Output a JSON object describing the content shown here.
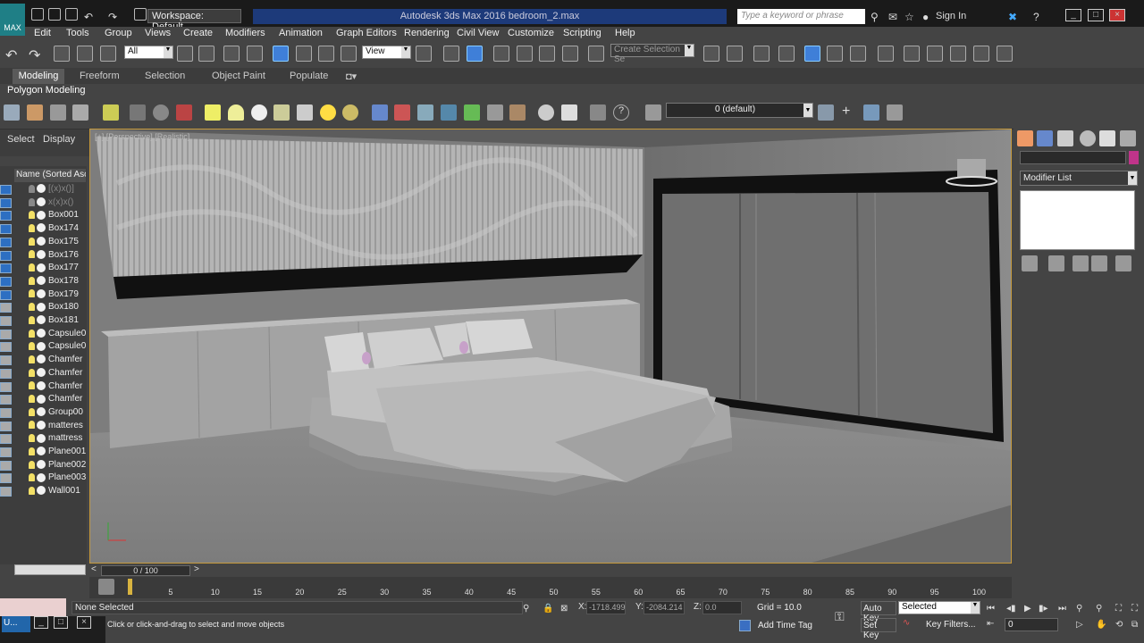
{
  "titlebar": {
    "logo_label": "MAX",
    "workspace": "Workspace: Default",
    "app_title": "Autodesk 3ds Max 2016     bedroom_2.max",
    "search_placeholder": "Type a keyword or phrase",
    "sign_in": "Sign In"
  },
  "menu": [
    "Edit",
    "Tools",
    "Group",
    "Views",
    "Create",
    "Modifiers",
    "Animation",
    "Graph Editors",
    "Rendering",
    "Civil View",
    "Customize",
    "Scripting",
    "Help"
  ],
  "toolbar": {
    "selection_filter": "All",
    "ref_coord": "View",
    "named_selection": "Create Selection Se"
  },
  "ribbon": {
    "tabs": [
      "Modeling",
      "Freeform",
      "Selection",
      "Object Paint",
      "Populate"
    ],
    "panel_label": "Polygon Modeling"
  },
  "layer": {
    "current": "0 (default)"
  },
  "scene_explorer": {
    "tabs": [
      "Select",
      "Display"
    ],
    "column_header": "Name (Sorted Ascer",
    "items": [
      {
        "name": "[(x)x()]",
        "dim": true
      },
      {
        "name": "x(x)x()",
        "dim": true
      },
      {
        "name": "Box001",
        "dim": false
      },
      {
        "name": "Box174",
        "dim": false
      },
      {
        "name": "Box175",
        "dim": false
      },
      {
        "name": "Box176",
        "dim": false
      },
      {
        "name": "Box177",
        "dim": false
      },
      {
        "name": "Box178",
        "dim": false
      },
      {
        "name": "Box179",
        "dim": false
      },
      {
        "name": "Box180",
        "dim": false
      },
      {
        "name": "Box181",
        "dim": false
      },
      {
        "name": "Capsule0",
        "dim": false
      },
      {
        "name": "Capsule0",
        "dim": false
      },
      {
        "name": "Chamfer",
        "dim": false
      },
      {
        "name": "Chamfer",
        "dim": false
      },
      {
        "name": "Chamfer",
        "dim": false
      },
      {
        "name": "Chamfer",
        "dim": false
      },
      {
        "name": "Group00",
        "dim": false
      },
      {
        "name": "matteres",
        "dim": false
      },
      {
        "name": "mattress",
        "dim": false
      },
      {
        "name": "Plane001",
        "dim": false
      },
      {
        "name": "Plane002",
        "dim": false
      },
      {
        "name": "Plane003",
        "dim": false
      },
      {
        "name": "Wall001",
        "dim": false
      }
    ]
  },
  "viewport": {
    "label": "[+] [Perspective] [Realistic]"
  },
  "command_panel": {
    "modifier_list": "Modifier List"
  },
  "timeline": {
    "slider": "0 / 100",
    "ticks": [
      "5",
      "10",
      "15",
      "20",
      "25",
      "30",
      "35",
      "40",
      "45",
      "50",
      "55",
      "60",
      "65",
      "70",
      "75",
      "80",
      "85",
      "90",
      "95",
      "100"
    ]
  },
  "status": {
    "selection": "None Selected",
    "prompt": "Click or click-and-drag to select and move objects",
    "x_label": "X:",
    "x_value": "-1718.499",
    "y_label": "Y:",
    "y_value": "-2084.214",
    "z_label": "Z:",
    "z_value": "0.0",
    "grid": "Grid = 10.0",
    "add_time_tag": "Add Time Tag",
    "auto_key": "Auto Key",
    "set_key": "Set Key",
    "key_mode": "Selected",
    "key_filters": "Key Filters...",
    "frame": "0"
  },
  "taskbar": {
    "item_label": "U..."
  }
}
